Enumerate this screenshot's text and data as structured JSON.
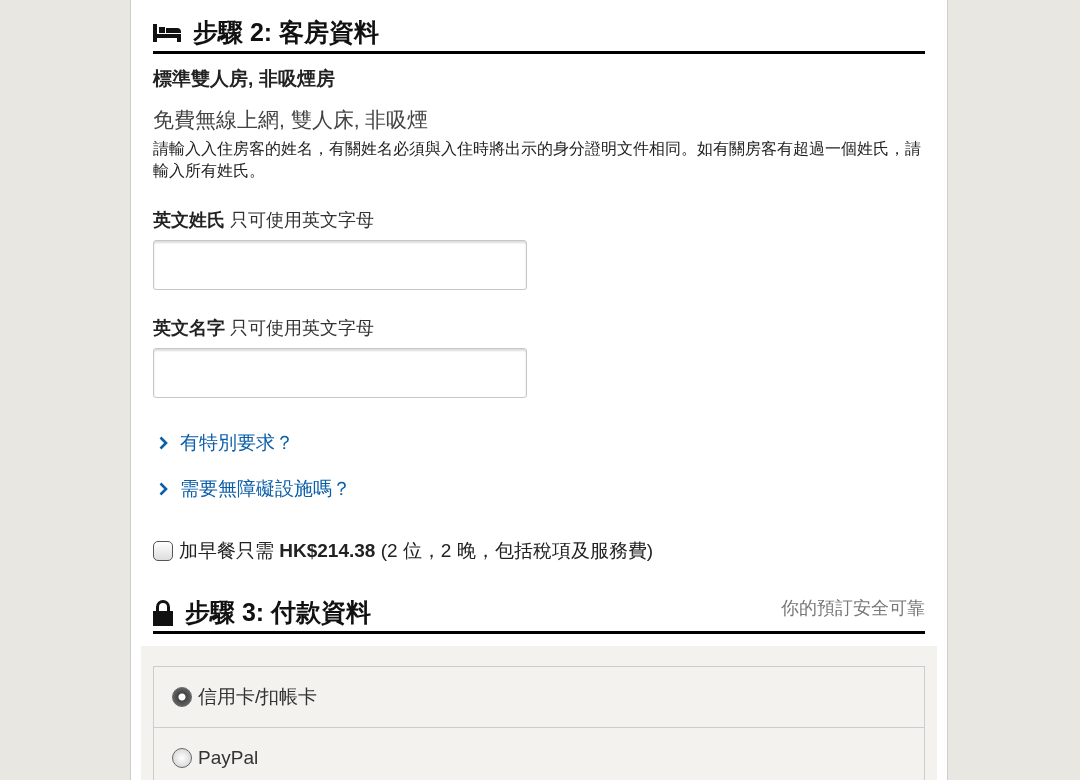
{
  "step2": {
    "kind": "bed",
    "title": "步驟 2: 客房資料",
    "room_name": "標準雙人房, 非吸煙房",
    "amenities": "免費無線上網, 雙人床, 非吸煙",
    "instructions": "請輸入入住房客的姓名，有關姓名必須與入住時將出示的身分證明文件相同。如有關房客有超過一個姓氏，請輸入所有姓氏。",
    "fields": [
      {
        "label": "英文姓氏",
        "hint": "只可使用英文字母"
      },
      {
        "label": "英文名字",
        "hint": "只可使用英文字母"
      }
    ],
    "links": [
      {
        "label": "有特別要求？"
      },
      {
        "label": "需要無障礙設施嗎？"
      }
    ],
    "breakfast": {
      "checked": false,
      "text": "加早餐只需 **HK$214.38** (2 位，2 晚，包括稅項及服務費)"
    }
  },
  "step3": {
    "kind": "lock",
    "title": "步驟 3: 付款資料",
    "note": "你的預訂安全可靠",
    "payment_options": [
      {
        "label": "信用卡/扣帳卡",
        "selected": true
      },
      {
        "label": "PayPal",
        "selected": false
      }
    ]
  }
}
